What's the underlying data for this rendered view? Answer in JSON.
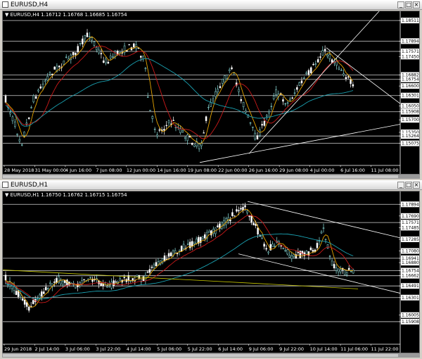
{
  "windows": [
    {
      "id": "h4",
      "title": "EURUSD,H4",
      "info": "▼ EURUSD,H4  1.16712 1.16768 1.16685 1.16754",
      "price_axis": [
        {
          "label": "1.18511",
          "y": 0.015,
          "box": false
        },
        {
          "label": "1.17894",
          "y": 0.155,
          "box": false
        },
        {
          "label": "1.17571",
          "y": 0.225,
          "box": false
        },
        {
          "label": "1.17450",
          "y": 0.26,
          "box": false
        },
        {
          "label": "1.16882",
          "y": 0.385,
          "box": false
        },
        {
          "label": "1.16754",
          "y": 0.415,
          "box": true
        },
        {
          "label": "1.16600",
          "y": 0.46,
          "box": false
        },
        {
          "label": "1.16301",
          "y": 0.525,
          "box": false
        },
        {
          "label": "1.16050",
          "y": 0.595,
          "box": false
        },
        {
          "label": "1.15908",
          "y": 0.635,
          "box": false
        },
        {
          "label": "1.15700",
          "y": 0.69,
          "box": false
        },
        {
          "label": "1.15350",
          "y": 0.775,
          "box": false
        },
        {
          "label": "1.15264",
          "y": 0.8,
          "box": false
        },
        {
          "label": "1.15075",
          "y": 0.85,
          "box": false
        }
      ],
      "time_axis": [
        "28 May 2018",
        "31 May 00:00",
        "4 Jun 16:00",
        "7 Jun 08:00",
        "12 Jun 00:00",
        "14 Jun 16:00",
        "19 Jun 08:00",
        "22 Jun 00:00",
        "26 Jun 16:00",
        "29 Jun 08:00",
        "4 Jul 00:00",
        "6 Jul 16:00",
        "11 Jul 08:00"
      ],
      "hlines": [
        0.015,
        0.155,
        0.225,
        0.385,
        0.415,
        0.525,
        0.635,
        0.8,
        0.85
      ],
      "colors": {
        "up": "#8fe3e0",
        "down": "#ffffff",
        "ma_fast": "#e6a400",
        "ma_mid": "#cc1a1a",
        "ma_slow": "#1aa0b0"
      }
    },
    {
      "id": "h1",
      "title": "EURUSD,H1",
      "info": "▼ EURUSD,H1  1.16750 1.16762 1.16715 1.16754",
      "price_axis": [
        {
          "label": "1.17894",
          "y": 0.04,
          "box": false
        },
        {
          "label": "1.17690",
          "y": 0.12,
          "box": false
        },
        {
          "label": "1.17571",
          "y": 0.165,
          "box": false
        },
        {
          "label": "1.17485",
          "y": 0.2,
          "box": false
        },
        {
          "label": "1.17285",
          "y": 0.28,
          "box": false
        },
        {
          "label": "1.17080",
          "y": 0.36,
          "box": false
        },
        {
          "label": "1.16941",
          "y": 0.41,
          "box": false
        },
        {
          "label": "1.16880",
          "y": 0.44,
          "box": false
        },
        {
          "label": "1.16754",
          "y": 0.495,
          "box": true
        },
        {
          "label": "1.16662",
          "y": 0.53,
          "box": false
        },
        {
          "label": "1.16491",
          "y": 0.6,
          "box": false
        },
        {
          "label": "1.16301",
          "y": 0.68,
          "box": false
        },
        {
          "label": "1.16005",
          "y": 0.8,
          "box": false
        },
        {
          "label": "1.15908",
          "y": 0.845,
          "box": false
        }
      ],
      "time_axis": [
        "29 Jun 2018",
        "2 Jul 14:00",
        "3 Jul 06:00",
        "3 Jul 22:00",
        "4 Jul 14:00",
        "5 Jul 06:00",
        "5 Jul 22:00",
        "6 Jul 14:00",
        "9 Jul 06:00",
        "9 Jul 22:00",
        "10 Jul 14:00",
        "11 Jul 06:00",
        "11 Jul 22:00"
      ],
      "hlines": [
        0.04,
        0.165,
        0.41,
        0.495,
        0.53,
        0.6,
        0.68,
        0.845
      ],
      "colors": {
        "up": "#8fe3e0",
        "down": "#ffffff",
        "ma_fast": "#e6a400",
        "ma_mid": "#cc1a1a",
        "ma_slow": "#1aa0b0"
      }
    }
  ]
}
